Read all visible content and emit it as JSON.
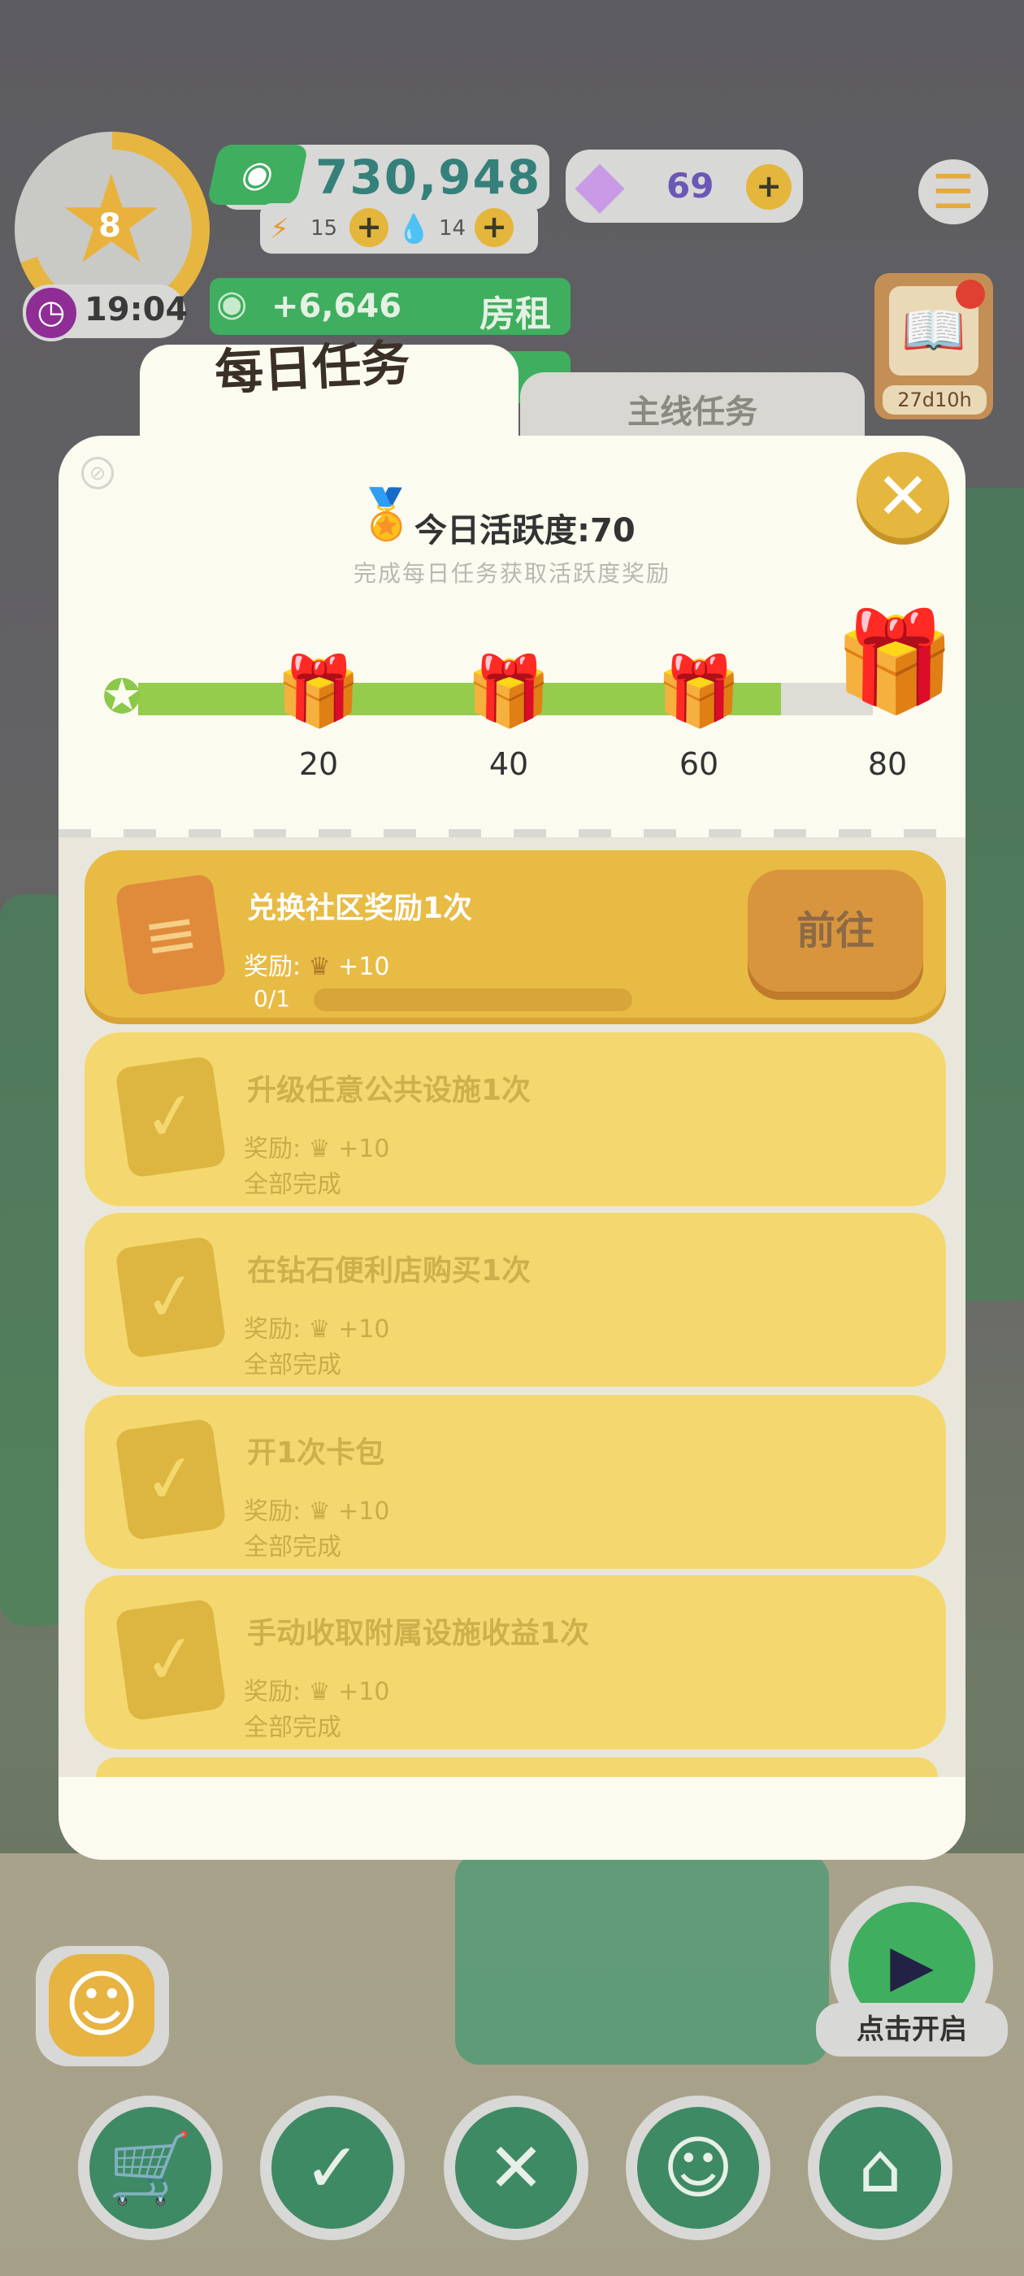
{
  "hud": {
    "level": "8",
    "timer": "19:04",
    "cash": "730,948",
    "resource_a": "15",
    "resource_b": "14",
    "gems": "69",
    "rent_value": "+6,646",
    "rent_label": "房租",
    "event_timer": "27d10h",
    "icons": {
      "level": "star-icon",
      "timer": "clock-icon",
      "cash": "cash-icon",
      "resource_a": "lightning-icon",
      "resource_b": "drop-icon",
      "gems": "gem-icon",
      "menu": "menu-icon",
      "event": "event-book-icon"
    }
  },
  "tabs": [
    {
      "label": "每日任务",
      "active": true
    },
    {
      "label": "主线任务",
      "active": false
    }
  ],
  "activity": {
    "title": "今日活跃度:70",
    "subtitle": "完成每日任务获取活跃度奖励",
    "progress": 70,
    "max": 80,
    "milestones": [
      "20",
      "40",
      "60",
      "80"
    ]
  },
  "tasks": [
    {
      "title": "兑换社区奖励1次",
      "reward": "奖励: ",
      "reward_value": "+10",
      "progress": "0/1",
      "status": "",
      "action": "前往",
      "state": "active"
    },
    {
      "title": "升级任意公共设施1次",
      "reward": "奖励: ",
      "reward_value": "+10",
      "progress": "",
      "status": "全部完成",
      "action": "",
      "state": "done"
    },
    {
      "title": "在钻石便利店购买1次",
      "reward": "奖励: ",
      "reward_value": "+10",
      "progress": "",
      "status": "全部完成",
      "action": "",
      "state": "done"
    },
    {
      "title": "开1次卡包",
      "reward": "奖励: ",
      "reward_value": "+10",
      "progress": "",
      "status": "全部完成",
      "action": "",
      "state": "done"
    },
    {
      "title": "手动收取附属设施收益1次",
      "reward": "奖励: ",
      "reward_value": "+10",
      "progress": "",
      "status": "全部完成",
      "action": "",
      "state": "done"
    }
  ],
  "bottom": {
    "tv_label": "点击开启",
    "nav": [
      {
        "name": "shop",
        "icon": "cart-icon"
      },
      {
        "name": "tasks",
        "icon": "clipboard-check-icon"
      },
      {
        "name": "build",
        "icon": "tools-icon"
      },
      {
        "name": "residents",
        "icon": "face-icon"
      },
      {
        "name": "home",
        "icon": "house-icon"
      }
    ]
  },
  "colors": {
    "accent": "#e6b73f",
    "green": "#3fae5f",
    "progress": "#95cc4c",
    "card_active": "#e8bb45",
    "card_done": "#f4d86f"
  }
}
